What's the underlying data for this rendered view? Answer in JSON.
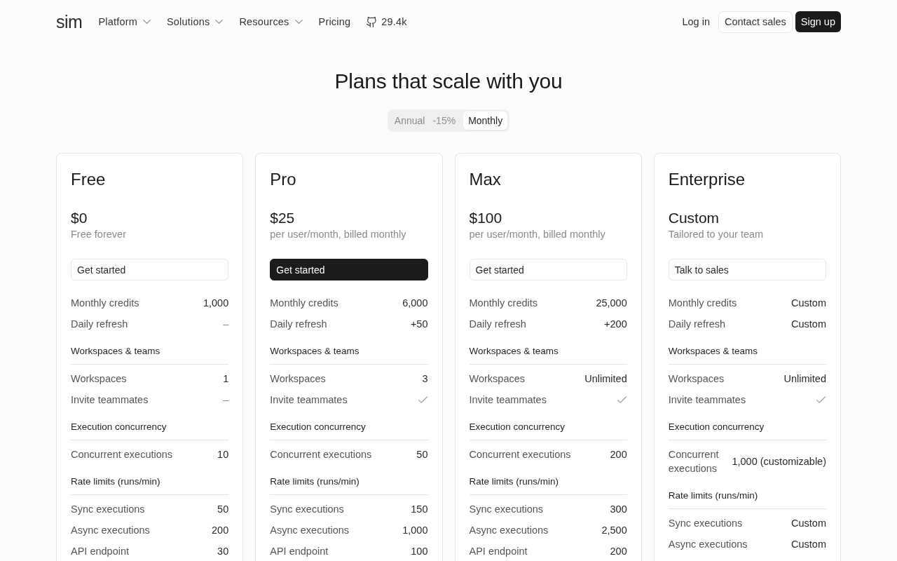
{
  "nav": {
    "logo": "sim",
    "links": [
      {
        "label": "Platform",
        "dropdown": true
      },
      {
        "label": "Solutions",
        "dropdown": true
      },
      {
        "label": "Resources",
        "dropdown": true
      },
      {
        "label": "Pricing",
        "dropdown": false
      }
    ],
    "github_stars": "29.4k",
    "actions": [
      {
        "label": "Log in",
        "kind": "link"
      },
      {
        "label": "Contact sales",
        "kind": "outline"
      },
      {
        "label": "Sign up",
        "kind": "solid"
      }
    ]
  },
  "heading": "Plans that scale with you",
  "billing_toggle": [
    {
      "label": "Annual",
      "badge": "-15%",
      "selected": false
    },
    {
      "label": "Monthly",
      "selected": true
    }
  ],
  "plans": [
    {
      "name": "Free",
      "price": "$0",
      "note": "Free forever",
      "button": {
        "label": "Get started",
        "primary": false
      },
      "rows": [
        {
          "label": "Monthly credits",
          "kind": "value",
          "value": "1,000"
        },
        {
          "label": "Daily refresh",
          "kind": "none",
          "value": "–"
        }
      ],
      "sections": [
        {
          "title": "Workspaces & teams",
          "rows": [
            {
              "label": "Workspaces",
              "kind": "value",
              "value": "1"
            },
            {
              "label": "Invite teammates",
              "kind": "none",
              "value": "–"
            }
          ]
        },
        {
          "title": "Execution concurrency",
          "rows": [
            {
              "label": "Concurrent executions",
              "kind": "value",
              "value": "10"
            }
          ]
        },
        {
          "title": "Rate limits (runs/min)",
          "rows": [
            {
              "label": "Sync executions",
              "kind": "value",
              "value": "50"
            },
            {
              "label": "Async executions",
              "kind": "value",
              "value": "200"
            },
            {
              "label": "API endpoint",
              "kind": "value",
              "value": "30"
            }
          ]
        }
      ]
    },
    {
      "name": "Pro",
      "price": "$25",
      "note": "per user/month, billed monthly",
      "button": {
        "label": "Get started",
        "primary": true
      },
      "rows": [
        {
          "label": "Monthly credits",
          "kind": "value",
          "value": "6,000"
        },
        {
          "label": "Daily refresh",
          "kind": "value",
          "value": "+50"
        }
      ],
      "sections": [
        {
          "title": "Workspaces & teams",
          "rows": [
            {
              "label": "Workspaces",
              "kind": "value",
              "value": "3"
            },
            {
              "label": "Invite teammates",
              "kind": "check"
            }
          ]
        },
        {
          "title": "Execution concurrency",
          "rows": [
            {
              "label": "Concurrent executions",
              "kind": "value",
              "value": "50"
            }
          ]
        },
        {
          "title": "Rate limits (runs/min)",
          "rows": [
            {
              "label": "Sync executions",
              "kind": "value",
              "value": "150"
            },
            {
              "label": "Async executions",
              "kind": "value",
              "value": "1,000"
            },
            {
              "label": "API endpoint",
              "kind": "value",
              "value": "100"
            }
          ]
        }
      ]
    },
    {
      "name": "Max",
      "price": "$100",
      "note": "per user/month, billed monthly",
      "button": {
        "label": "Get started",
        "primary": false
      },
      "rows": [
        {
          "label": "Monthly credits",
          "kind": "value",
          "value": "25,000"
        },
        {
          "label": "Daily refresh",
          "kind": "value",
          "value": "+200"
        }
      ],
      "sections": [
        {
          "title": "Workspaces & teams",
          "rows": [
            {
              "label": "Workspaces",
              "kind": "value",
              "value": "Unlimited"
            },
            {
              "label": "Invite teammates",
              "kind": "check"
            }
          ]
        },
        {
          "title": "Execution concurrency",
          "rows": [
            {
              "label": "Concurrent executions",
              "kind": "value",
              "value": "200"
            }
          ]
        },
        {
          "title": "Rate limits (runs/min)",
          "rows": [
            {
              "label": "Sync executions",
              "kind": "value",
              "value": "300"
            },
            {
              "label": "Async executions",
              "kind": "value",
              "value": "2,500"
            },
            {
              "label": "API endpoint",
              "kind": "value",
              "value": "200"
            }
          ]
        }
      ]
    },
    {
      "name": "Enterprise",
      "price": "Custom",
      "note": "Tailored to your team",
      "button": {
        "label": "Talk to sales",
        "primary": false
      },
      "rows": [
        {
          "label": "Monthly credits",
          "kind": "value",
          "value": "Custom"
        },
        {
          "label": "Daily refresh",
          "kind": "value",
          "value": "Custom"
        }
      ],
      "sections": [
        {
          "title": "Workspaces & teams",
          "rows": [
            {
              "label": "Workspaces",
              "kind": "value",
              "value": "Unlimited"
            },
            {
              "label": "Invite teammates",
              "kind": "check"
            }
          ]
        },
        {
          "title": "Execution concurrency",
          "rows": [
            {
              "label": "Concurrent executions",
              "kind": "value",
              "value": "1,000 (customizable)"
            }
          ]
        },
        {
          "title": "Rate limits (runs/min)",
          "rows": [
            {
              "label": "Sync executions",
              "kind": "value",
              "value": "Custom"
            },
            {
              "label": "Async executions",
              "kind": "value",
              "value": "Custom"
            }
          ]
        }
      ]
    }
  ]
}
